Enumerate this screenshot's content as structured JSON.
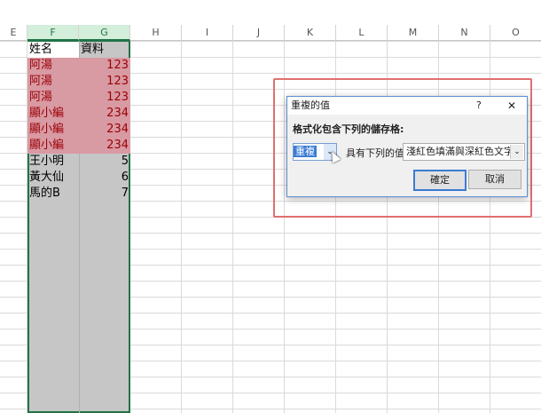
{
  "columns": [
    "E",
    "F",
    "G",
    "H",
    "I",
    "J",
    "K",
    "L",
    "M",
    "N",
    "O"
  ],
  "rows": [
    {
      "name": "姓名",
      "value": "資料",
      "dup": false,
      "header": true
    },
    {
      "name": "阿湯",
      "value": "123",
      "dup": true
    },
    {
      "name": "阿湯",
      "value": "123",
      "dup": true
    },
    {
      "name": "阿湯",
      "value": "123",
      "dup": true
    },
    {
      "name": "顯小編",
      "value": "234",
      "dup": true
    },
    {
      "name": "顯小編",
      "value": "234",
      "dup": true
    },
    {
      "name": "顯小編",
      "value": "234",
      "dup": true
    },
    {
      "name": "王小明",
      "value": "5",
      "dup": false
    },
    {
      "name": "黃大仙",
      "value": "6",
      "dup": false
    },
    {
      "name": "馬的B",
      "value": "7",
      "dup": false
    }
  ],
  "dialog": {
    "title": "重複的值",
    "help": "?",
    "close": "✕",
    "instruction": "格式化包含下列的儲存格:",
    "type_value": "重複",
    "with_label": "具有下列的值",
    "format_value": "淺紅色填滿與深紅色文字",
    "ok": "確定",
    "cancel": "取消"
  },
  "colors": {
    "duplicate_fill": "#d89aa3",
    "duplicate_text": "#9c0006",
    "selection_border": "#217346",
    "highlight_box": "#e07070"
  }
}
